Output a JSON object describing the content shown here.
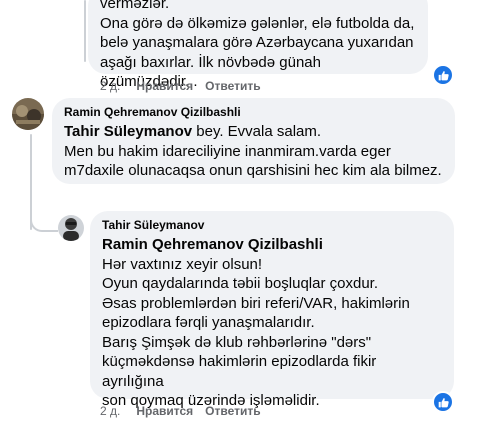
{
  "comment_top": {
    "lines": [
      "verməzlər.",
      "Ona görə də ölkəmizə gələnlər, elə futbolda da,",
      "belə yanaşmalara görə Azərbaycana yuxarıdan",
      "aşağı baxırlar. İlk növbədə günah özümüzdədir..."
    ],
    "time": "2 д.",
    "like_label": "Нравится",
    "reply_label": "Ответить"
  },
  "comment_ramin": {
    "author": "Ramin Qehremanov Qizilbashli",
    "mention": "Tahir Süleymanov",
    "first_line_rest": " bey. Evvala salam.",
    "lines": [
      "Men bu hakim idareciliyine inanmiram.varda eger",
      "m7daxile olunacaqsa onun qarshisini hec kim ala bilmez."
    ]
  },
  "comment_tahir": {
    "author": "Tahir Süleymanov",
    "mention": "Ramin Qehremanov Qizilbashli",
    "lines": [
      "Hər vaxtınız xeyir olsun!",
      "Oyun qaydalarında təbii boşluqlar çoxdur.",
      "Əsas problemlərdən biri referi/VAR, hakimlərin",
      "epizodlara fərqli yanaşmalarıdır.",
      "Barış Şimşək də klub rəhbərlərinə \"dərs\"",
      "küçməkdənsə hakimlərin epizodlarda fikir ayrılığına",
      "son qoymaq üzərində işləməlidir."
    ],
    "time": "2 д.",
    "like_label": "Нравится",
    "reply_label": "Ответить"
  },
  "colors": {
    "bubble_bg": "#f0f2f5",
    "action_text": "#65676b",
    "like_blue": "#1b74e4",
    "thread_line": "#ccd0d5"
  },
  "icons": {
    "like_badge": "thumbs-up-icon",
    "avatar_ramin": "user-avatar",
    "avatar_tahir": "user-avatar"
  }
}
